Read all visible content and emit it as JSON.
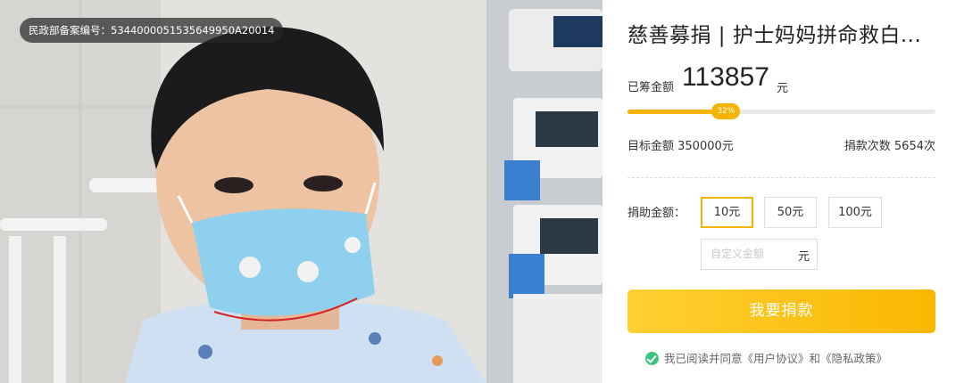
{
  "photo": {
    "badge_text": "民政部备案编号：5344000051535649950A20014",
    "alt": "photo"
  },
  "campaign": {
    "title": "慈善募捐 | 护士妈妈拼命救白...",
    "raised_label": "已筹金额",
    "raised_amount": "113857",
    "raised_unit": "元",
    "progress_percent": 32,
    "progress_label": "32%",
    "target_text": "目标金额 350000元",
    "donation_count_text": "捐款次数 5654次"
  },
  "donate": {
    "amount_label": "捐助金额：",
    "amounts": [
      "10元",
      "50元",
      "100元"
    ],
    "selected_index": 0,
    "custom_placeholder": "自定义金额",
    "custom_unit": "元",
    "button_label": "我要捐款",
    "agreement_text": "我已阅读并同意《用户协议》和《隐私政策》"
  },
  "colors": {
    "accent": "#f5b400",
    "check": "#3cc47c"
  }
}
